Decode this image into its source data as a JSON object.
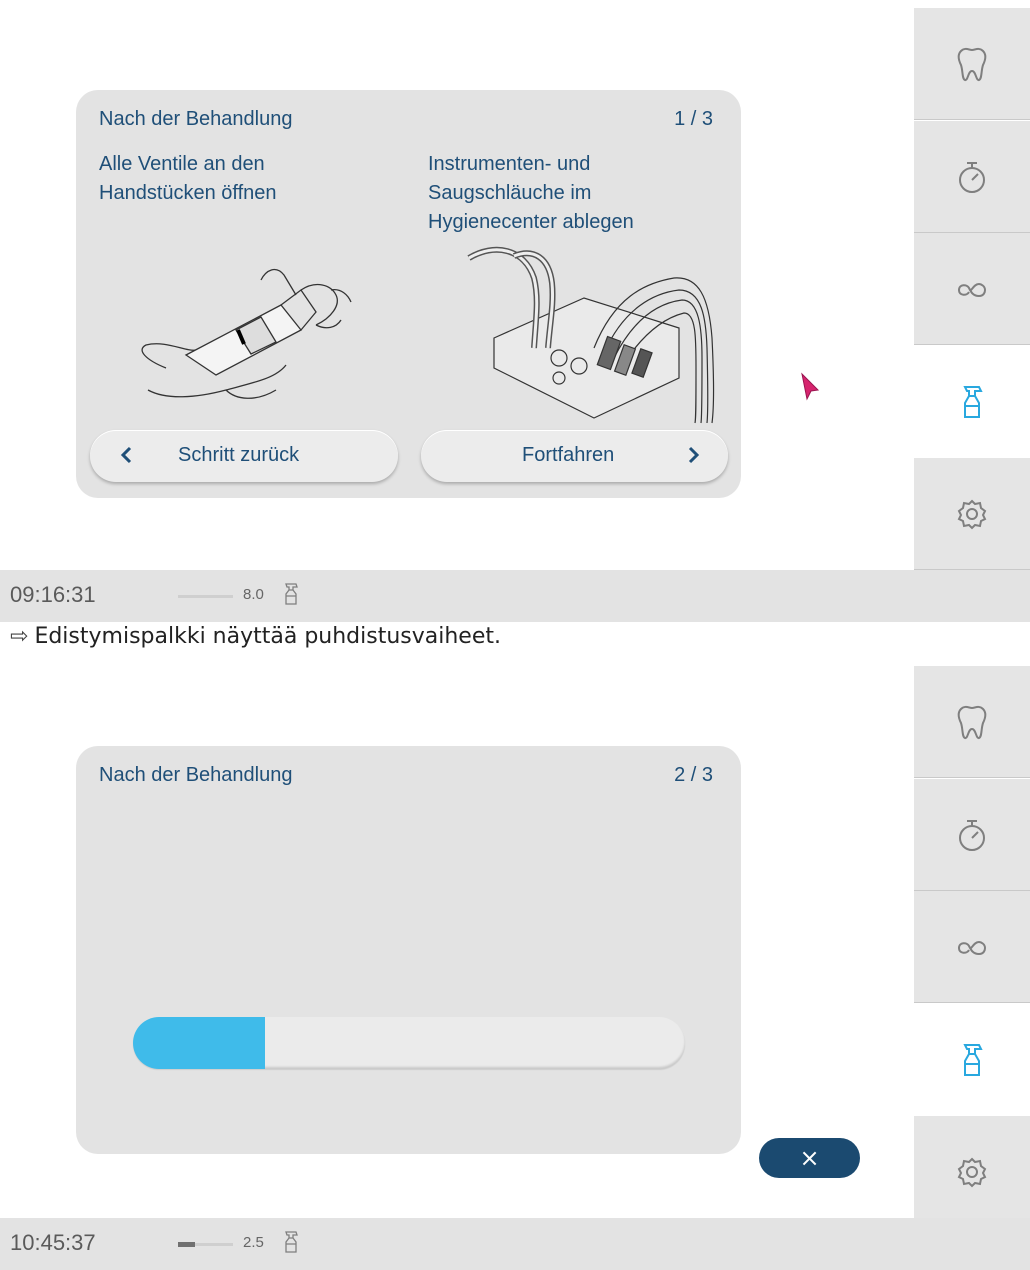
{
  "screen1": {
    "dialog": {
      "title": "Nach der Behandlung",
      "step": "1 / 3",
      "instruction_left": [
        "Alle Ventile an den",
        "Handstücken öffnen"
      ],
      "instruction_right": [
        "Instrumenten- und",
        "Saugschläuche im",
        "Hygienecenter ablegen"
      ],
      "back_button": "Schritt zurück",
      "continue_button": "Fortfahren"
    },
    "status": {
      "time": "09:16:31",
      "value": "8.0",
      "level": 0
    }
  },
  "caption": {
    "arrow": "⇨",
    "text": "Edistymispalkki näyttää puhdistusvaiheet."
  },
  "screen2": {
    "dialog": {
      "title": "Nach der Behandlung",
      "step": "2 / 3",
      "progress_percent": 24
    },
    "close_button": "×",
    "status": {
      "time": "10:45:37",
      "value": "2.5",
      "level": 0.3
    }
  },
  "sidebar": {
    "items": [
      {
        "icon": "tooth-icon"
      },
      {
        "icon": "stopwatch-icon"
      },
      {
        "icon": "loop-icon"
      },
      {
        "icon": "spray-bottle-icon",
        "active": true
      },
      {
        "icon": "gear-icon"
      }
    ]
  },
  "colors": {
    "accent": "#3fbbea",
    "text": "#1f4f78",
    "close_button": "#1b4a70",
    "panel": "#e3e3e3",
    "active_icon": "#29a8df",
    "inactive_icon": "#7f7f7f"
  }
}
